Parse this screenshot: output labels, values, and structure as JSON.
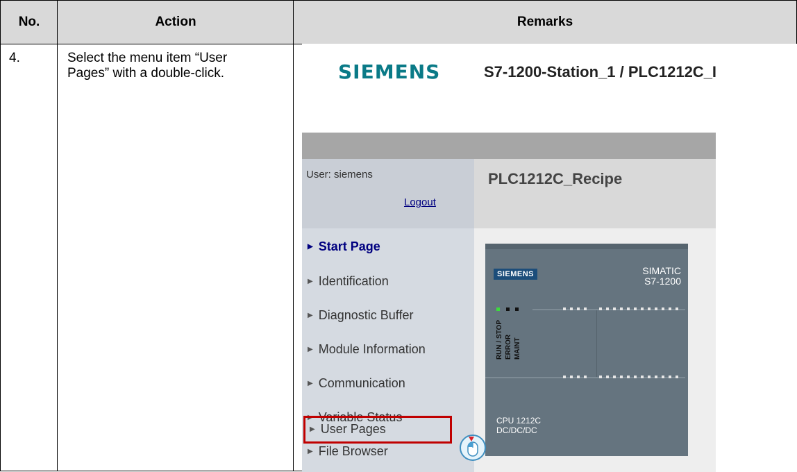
{
  "table": {
    "headers": {
      "no": "No.",
      "action": "Action",
      "remarks": "Remarks"
    },
    "row": {
      "no": "4.",
      "action_line1": "Select the menu item “User",
      "action_line2": "Pages” with a double-click."
    }
  },
  "webpage": {
    "logo": "SIEMENS",
    "station_title": "S7-1200-Station_1 / PLC1212C_I",
    "user_label": "User: siemens",
    "logout": "Logout",
    "page_title": "PLC1212C_Recipe",
    "nav_items": [
      {
        "label": "Start Page",
        "active": true
      },
      {
        "label": "Identification",
        "active": false
      },
      {
        "label": "Diagnostic Buffer",
        "active": false
      },
      {
        "label": "Module Information",
        "active": false
      },
      {
        "label": "Communication",
        "active": false
      },
      {
        "label": "Variable Status",
        "active": false
      },
      {
        "label": "File Browser",
        "active": false
      },
      {
        "label": "User Pages",
        "active": false
      }
    ],
    "cpu": {
      "logo": "SIEMENS",
      "brand_line1": "SIMATIC",
      "brand_line2": "S7-1200",
      "led_labels": [
        "RUN / STOP",
        "ERROR",
        "MAINT"
      ],
      "model_line1": "CPU 1212C",
      "model_line2": "DC/DC/DC"
    }
  },
  "colors": {
    "header_bg": "#d9d9d9",
    "siemens_teal": "#0a7a87",
    "nav_active": "#000080",
    "highlight": "#c00000"
  }
}
